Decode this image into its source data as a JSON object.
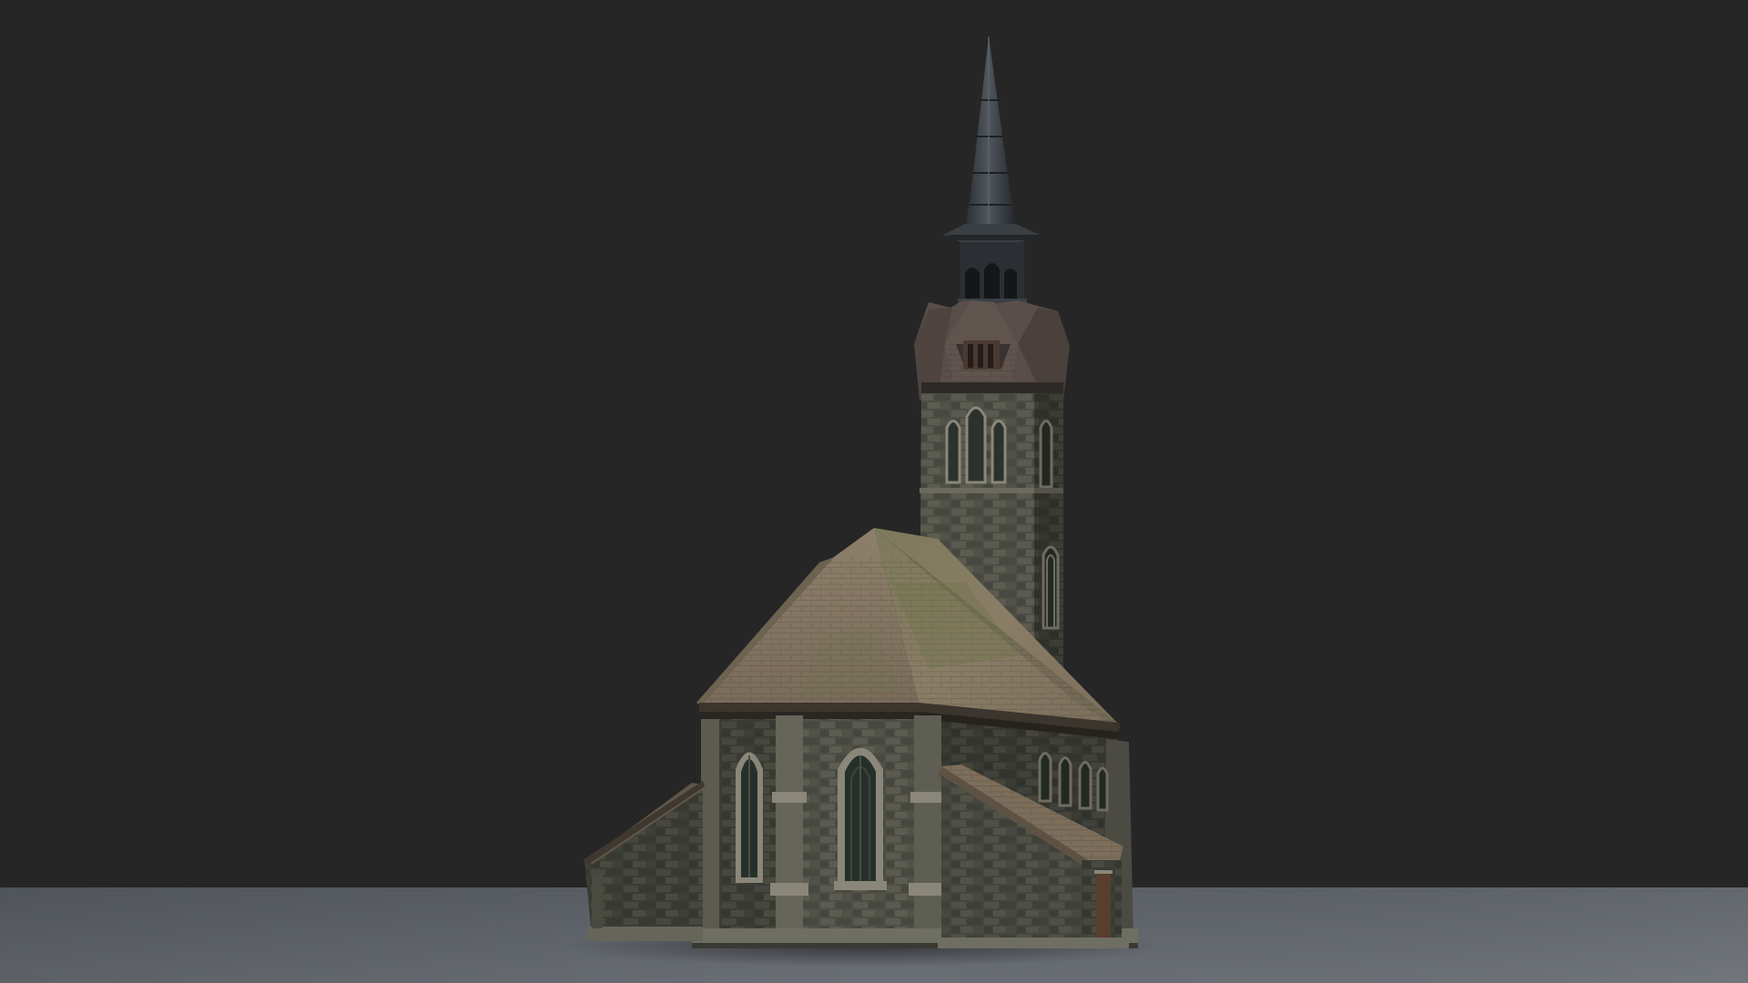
{
  "scene": {
    "subject": "church-3d-render",
    "colors": {
      "backdrop": "#262626",
      "floor_near": "#656a70",
      "floor_far": "#5a5f64",
      "stone_dark": "#3e3f38",
      "stone_mid": "#57584e",
      "stone_light": "#6e6d60",
      "trim_stone": "#8a877a",
      "roof_light": "#8a7c66",
      "roof_mid": "#75695a",
      "roof_dark": "#5e5446",
      "roof_moss": "#6f7452",
      "belfry_roof": "#5b4f4a",
      "spire": "#2e3236",
      "spire_highlight": "#4f565c",
      "window_glass": "#2a332c",
      "wood": "#5a3e2c"
    }
  }
}
